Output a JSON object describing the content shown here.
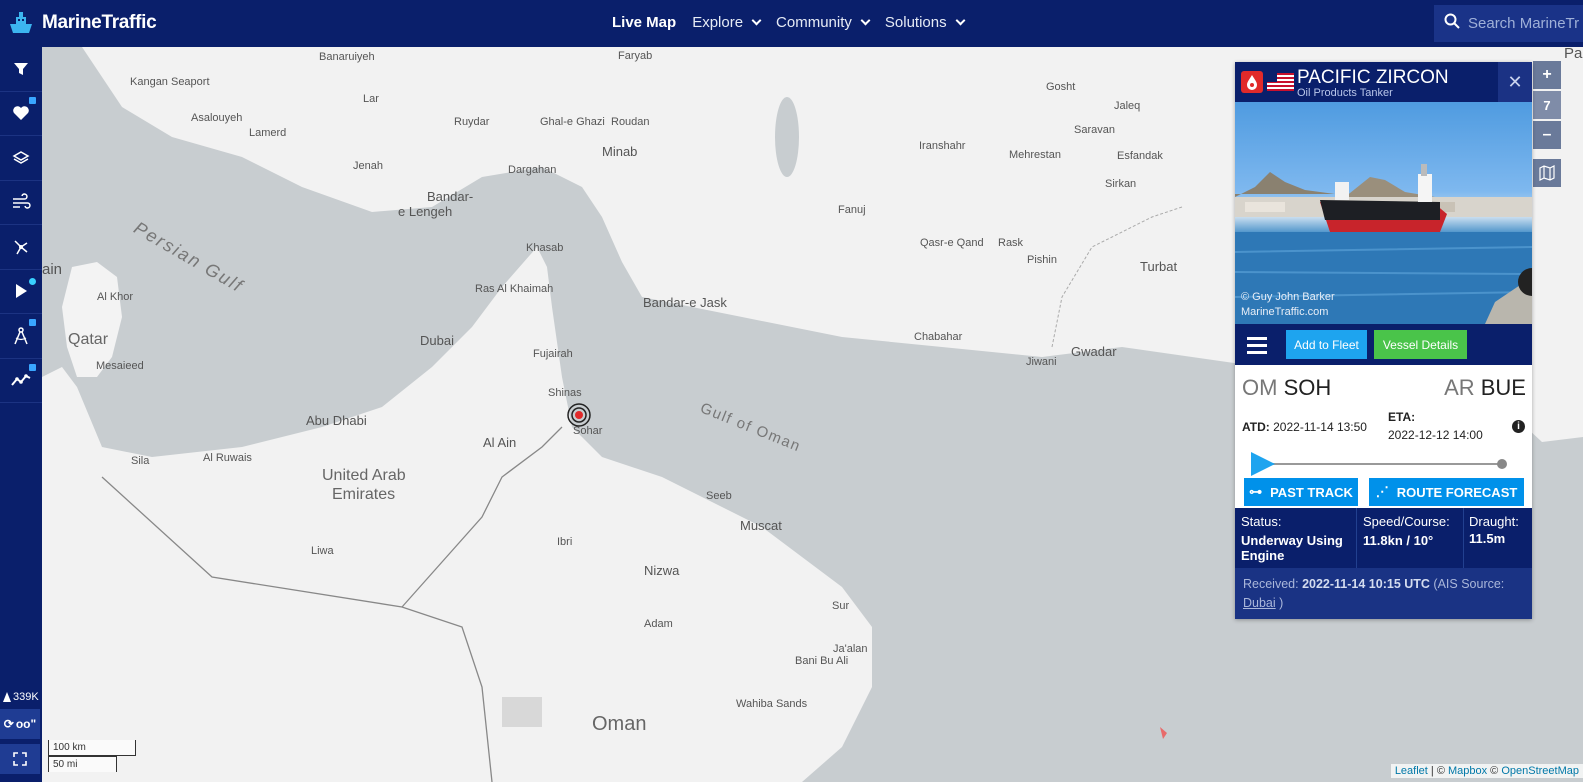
{
  "app": {
    "brand": "MarineTraffic",
    "nav": [
      {
        "label": "Live Map",
        "dropdown": false,
        "active": true
      },
      {
        "label": "Explore",
        "dropdown": true,
        "active": false
      },
      {
        "label": "Community",
        "dropdown": true,
        "active": false
      },
      {
        "label": "Solutions",
        "dropdown": true,
        "active": false
      }
    ],
    "search_placeholder": "Search MarineTr",
    "accent": "#0a1f6b"
  },
  "sidebar": {
    "tools": [
      {
        "icon": "filter-icon",
        "locked": false
      },
      {
        "icon": "heart-icon",
        "locked": true
      },
      {
        "icon": "layers-icon",
        "locked": false
      },
      {
        "icon": "wind-icon",
        "locked": false
      },
      {
        "icon": "density-icon",
        "locked": false
      },
      {
        "icon": "play-icon",
        "locked": false
      },
      {
        "icon": "measure-icon",
        "locked": true
      },
      {
        "icon": "analytics-icon",
        "locked": true
      }
    ],
    "vessel_count": "339K",
    "bottom_label": "oo\""
  },
  "map": {
    "zoom_level": "7",
    "places": [
      {
        "name": "Banaruiyeh",
        "cls": ""
      },
      {
        "name": "Faryab",
        "cls": ""
      },
      {
        "name": "Kangan Seaport",
        "cls": ""
      },
      {
        "name": "Lar",
        "cls": ""
      },
      {
        "name": "Asalouyeh",
        "cls": ""
      },
      {
        "name": "Lamerd",
        "cls": ""
      },
      {
        "name": "Ruydar",
        "cls": ""
      },
      {
        "name": "Ghal-e Ghazi",
        "cls": ""
      },
      {
        "name": "Roudan",
        "cls": ""
      },
      {
        "name": "Minab",
        "cls": "big"
      },
      {
        "name": "Jenah",
        "cls": ""
      },
      {
        "name": "Dargahan",
        "cls": ""
      },
      {
        "name": "Bandar-",
        "cls": "big"
      },
      {
        "name": "e Lengeh",
        "cls": "big"
      },
      {
        "name": "Gosht",
        "cls": ""
      },
      {
        "name": "Jaleq",
        "cls": ""
      },
      {
        "name": "Saravan",
        "cls": ""
      },
      {
        "name": "Iranshahr",
        "cls": ""
      },
      {
        "name": "Mehrestan",
        "cls": ""
      },
      {
        "name": "Esfandak",
        "cls": ""
      },
      {
        "name": "Sirkan",
        "cls": ""
      },
      {
        "name": "Fanuj",
        "cls": ""
      },
      {
        "name": "Qasr-e Qand",
        "cls": ""
      },
      {
        "name": "Rask",
        "cls": ""
      },
      {
        "name": "Pishin",
        "cls": ""
      },
      {
        "name": "Turbat",
        "cls": "big"
      },
      {
        "name": "Khasab",
        "cls": ""
      },
      {
        "name": "Ras Al Khaimah",
        "cls": ""
      },
      {
        "name": "Bandar-e Jask",
        "cls": "big"
      },
      {
        "name": "Al Khor",
        "cls": ""
      },
      {
        "name": "Qatar",
        "cls": "country"
      },
      {
        "name": "Mesaieed",
        "cls": ""
      },
      {
        "name": "Dubai",
        "cls": "big"
      },
      {
        "name": "Fujairah",
        "cls": ""
      },
      {
        "name": "Chabahar",
        "cls": ""
      },
      {
        "name": "Jiwani",
        "cls": ""
      },
      {
        "name": "Gwadar",
        "cls": "big"
      },
      {
        "name": "Shinas",
        "cls": ""
      },
      {
        "name": "Abu Dhabi",
        "cls": "big"
      },
      {
        "name": "Sohar",
        "cls": ""
      },
      {
        "name": "Al Ain",
        "cls": "big"
      },
      {
        "name": "Sila",
        "cls": ""
      },
      {
        "name": "Al Ruwais",
        "cls": ""
      },
      {
        "name": "United Arab",
        "cls": "country"
      },
      {
        "name": "Emirates",
        "cls": "country"
      },
      {
        "name": "Seeb",
        "cls": ""
      },
      {
        "name": "Muscat",
        "cls": "big"
      },
      {
        "name": "Ibri",
        "cls": ""
      },
      {
        "name": "Nizwa",
        "cls": "big"
      },
      {
        "name": "Liwa",
        "cls": ""
      },
      {
        "name": "Sur",
        "cls": ""
      },
      {
        "name": "Adam",
        "cls": ""
      },
      {
        "name": "Ja'alan",
        "cls": ""
      },
      {
        "name": "Bani Bu Ali",
        "cls": ""
      },
      {
        "name": "Wahiba Sands",
        "cls": ""
      },
      {
        "name": "Oman",
        "cls": "country"
      },
      {
        "name": "Pak",
        "cls": "big"
      },
      {
        "name": "ain",
        "cls": "big"
      }
    ],
    "sea_labels": [
      "Persian Gulf",
      "Gulf of Oman"
    ],
    "scale_km": "100 km",
    "scale_mi": "50 mi",
    "attribution": {
      "leaflet": "Leaflet",
      "sep1": " | © ",
      "mapbox": "Mapbox",
      "sep2": " © ",
      "osm": "OpenStreetMap"
    }
  },
  "vessel": {
    "name": "PACIFIC ZIRCON",
    "type": "Oil Products Tanker",
    "photo_credit_1": "© Guy John Barker",
    "photo_credit_2": "MarineTraffic.com",
    "add_fleet_label": "Add to Fleet",
    "details_label": "Vessel Details",
    "origin_country": "OM",
    "origin_port": "SOH",
    "dest_country": "AR",
    "dest_port": "BUE",
    "atd_label": "ATD:",
    "atd_value": "2022-11-14 13:50",
    "eta_label": "ETA:",
    "eta_value": "2022-12-12 14:00",
    "past_track_label": "PAST TRACK",
    "route_forecast_label": "ROUTE FORECAST",
    "status_label": "Status:",
    "status_value": "Underway Using Engine",
    "speed_label": "Speed/Course:",
    "speed_value": "11.8kn / 10°",
    "draught_label": "Draught:",
    "draught_value": "11.5m",
    "received_label": "Received:",
    "received_value": "2022-11-14 10:15 UTC",
    "ais_source_label": "(AIS Source:",
    "ais_source_value": "Dubai",
    "ais_source_close": ")"
  }
}
